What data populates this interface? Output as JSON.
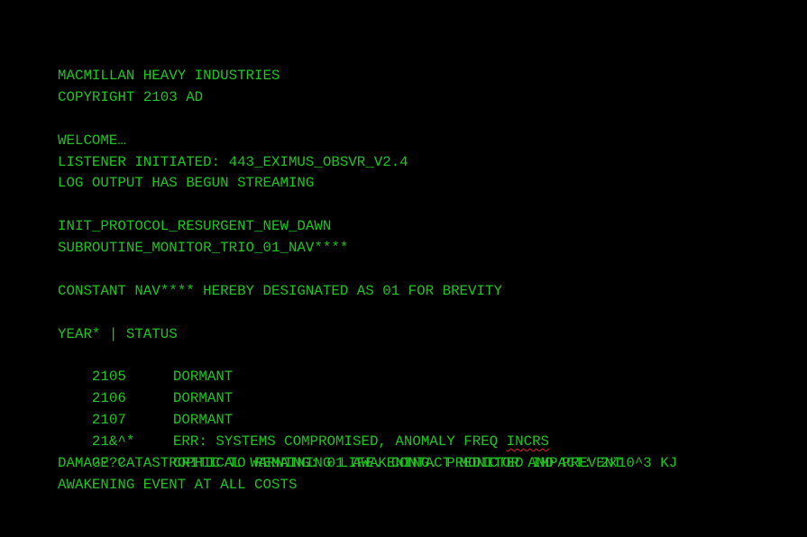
{
  "colors": {
    "background": "#000000",
    "text": "#22c322",
    "spellcheck_underline": "#e02020"
  },
  "header": {
    "company": "MACMILLAN HEAVY INDUSTRIES",
    "copyright": "COPYRIGHT 2103 AD"
  },
  "intro": {
    "welcome": "WELCOME…",
    "listener": "LISTENER INITIATED: 443_EXIMUS_OBSVR_V2.4",
    "log": "LOG OUTPUT HAS BEGUN STREAMING"
  },
  "protocol": {
    "init": "INIT_PROTOCOL_RESURGENT_NEW_DAWN",
    "subroutine": "SUBROUTINE_MONITOR_TRIO_01_NAV****"
  },
  "constant_line": "CONSTANT NAV**** HEREBY DESIGNATED AS 01 FOR BREVITY",
  "status_table": {
    "header": "YEAR* | STATUS",
    "rows": [
      {
        "year": "2105",
        "status": "DORMANT"
      },
      {
        "year": "2106",
        "status": "DORMANT"
      },
      {
        "year": "2107",
        "status": "DORMANT"
      },
      {
        "year": "21&^*",
        "status_prefix": "ERR: SYSTEMS COMPROMISED, ANOMALY FREQ ",
        "status_flagged": "INCRS"
      },
      {
        "year": "????",
        "status": "CRITICAL WARNING: 01 AWAKENING. PREDICTED IMPACT: 2x10^3 KJ"
      }
    ],
    "continuation": [
      "DAMAGE CATASTROPHIC TO REMAINING LIFE. CONTACT MONITOR AND PREVENT",
      "AWAKENING EVENT AT ALL COSTS"
    ]
  }
}
